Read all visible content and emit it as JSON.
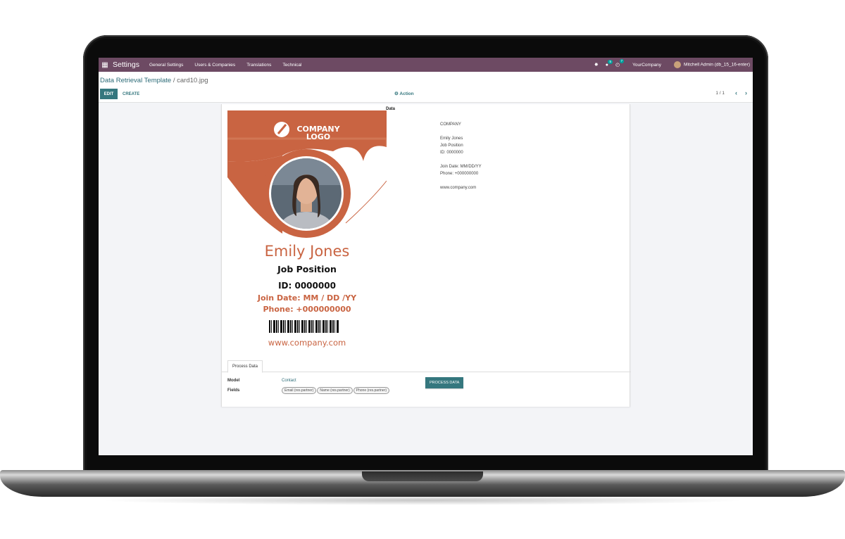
{
  "navbar": {
    "brand": "Settings",
    "menu": [
      "General Settings",
      "Users & Companies",
      "Translations",
      "Technical"
    ],
    "messages_count": "5",
    "activities_count": "7",
    "company": "YourCompany",
    "user": "Mitchell Admin (db_15_16-enter)"
  },
  "control": {
    "breadcrumb_parent": "Data Retrieval Template",
    "breadcrumb_sep": " / ",
    "breadcrumb_current": "card10.jpg",
    "edit_label": "EDIT",
    "create_label": "CREATE",
    "action_label": "Action",
    "pager": "1 / 1"
  },
  "card": {
    "logo_line1": "COMPANY",
    "logo_line2": "LOGO",
    "name": "Emily Jones",
    "job": "Job Position",
    "id": "ID: 0000000",
    "join": "Join Date: MM / DD /YY",
    "phone": "Phone: +000000000",
    "website": "www.company.com"
  },
  "data": {
    "label": "Data",
    "company": "COMPANY",
    "name": "Emily Jones",
    "job": "Job Position",
    "id": "ID: 0000000",
    "join": "Join Date: MM/DD/YY",
    "phone": "Phone: +000000000",
    "website": "www.company.com"
  },
  "tab": {
    "label": "Process Data"
  },
  "form": {
    "model_label": "Model",
    "model_value": "Contact",
    "fields_label": "Fields",
    "fields": [
      "Email (res.partner)",
      "Name (res.partner)",
      "Phone (res.partner)"
    ],
    "process_button": "PROCESS DATA"
  },
  "colors": {
    "navbar": "#6d4a63",
    "primary": "#35777e",
    "card_accent": "#c96442"
  },
  "icons": [
    "apps-grid-icon",
    "bug-icon",
    "chat-icon",
    "clock-icon",
    "gear-icon",
    "chevron-left-icon",
    "chevron-right-icon",
    "company-logo-icon",
    "barcode-icon"
  ]
}
